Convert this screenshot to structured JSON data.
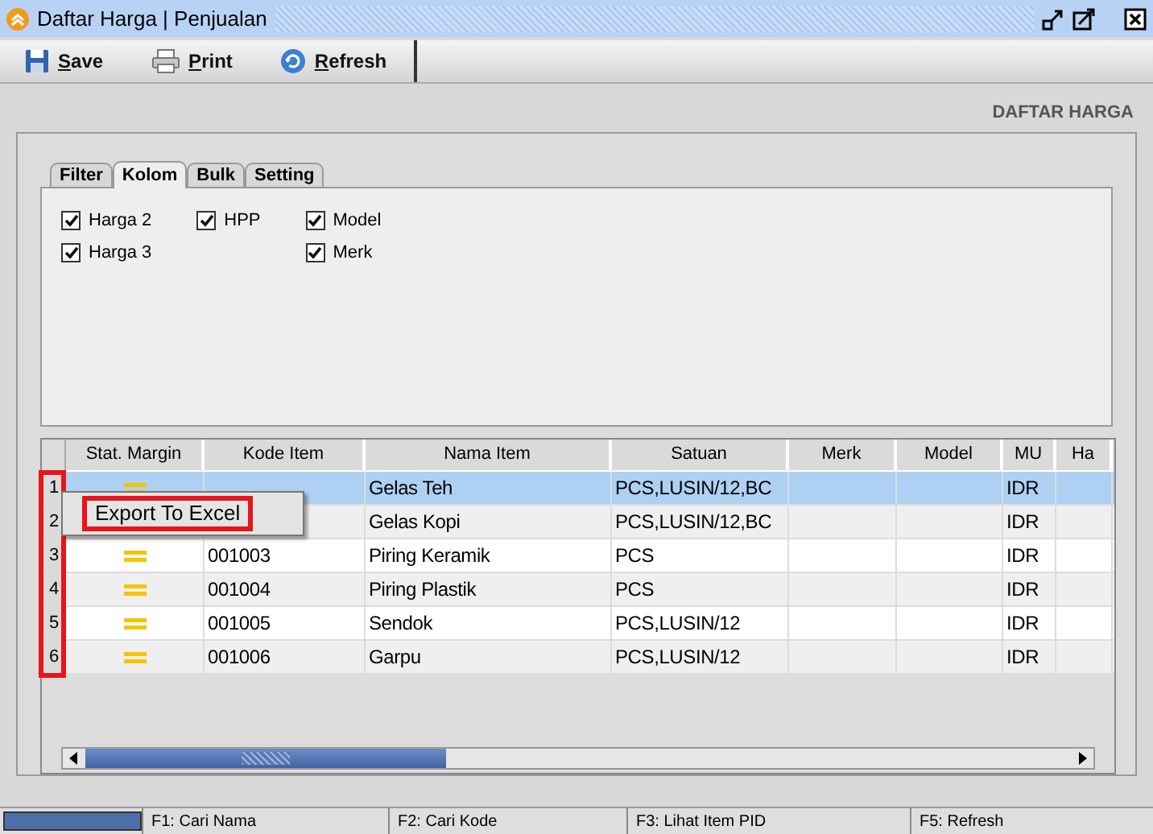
{
  "window": {
    "title": "Daftar Harga | Penjualan"
  },
  "toolbar": [
    {
      "kind": "save",
      "label": "Save"
    },
    {
      "kind": "print",
      "label": "Print"
    },
    {
      "kind": "refresh",
      "label": "Refresh"
    }
  ],
  "page_title": "DAFTAR HARGA",
  "tabs": [
    {
      "label": "Filter",
      "selected": false
    },
    {
      "label": "Kolom",
      "selected": true
    },
    {
      "label": "Bulk",
      "selected": false
    },
    {
      "label": "Setting",
      "selected": false
    }
  ],
  "column_options": [
    [
      {
        "label": "Harga 2",
        "checked": true
      },
      {
        "label": "Harga 3",
        "checked": true
      }
    ],
    [
      {
        "label": "HPP",
        "checked": true
      }
    ],
    [
      {
        "label": "Model",
        "checked": true
      },
      {
        "label": "Merk",
        "checked": true
      }
    ]
  ],
  "table": {
    "columns": [
      "Stat. Margin",
      "Kode Item",
      "Nama Item",
      "Satuan",
      "Merk",
      "Model",
      "MU",
      "Ha"
    ],
    "rows": [
      {
        "number": "1",
        "selected": true,
        "kind": "equal",
        "name": "Gelas Teh",
        "unit": "PCS,LUSIN/12,BC",
        "currency": "IDR"
      },
      {
        "number": "2",
        "selected": false,
        "name": "Gelas Kopi",
        "unit": "PCS,LUSIN/12,BC",
        "currency": "IDR"
      },
      {
        "number": "3",
        "selected": false,
        "kind": "equal",
        "code": "001003",
        "name": "Piring Keramik",
        "unit": "PCS",
        "currency": "IDR"
      },
      {
        "number": "4",
        "selected": false,
        "kind": "equal",
        "code": "001004",
        "name": "Piring Plastik",
        "unit": "PCS",
        "currency": "IDR"
      },
      {
        "number": "5",
        "selected": false,
        "kind": "equal",
        "code": "001005",
        "name": "Sendok",
        "unit": "PCS,LUSIN/12",
        "currency": "IDR"
      },
      {
        "number": "6",
        "selected": false,
        "kind": "equal",
        "code": "001006",
        "name": "Garpu",
        "unit": "PCS,LUSIN/12",
        "currency": "IDR"
      }
    ]
  },
  "context_menu": {
    "items": [
      "Export To Excel"
    ]
  },
  "status_bar": [
    "F1: Cari Nama",
    "F2: Cari Kode",
    "F3: Lihat Item PID",
    "F5: Refresh"
  ]
}
